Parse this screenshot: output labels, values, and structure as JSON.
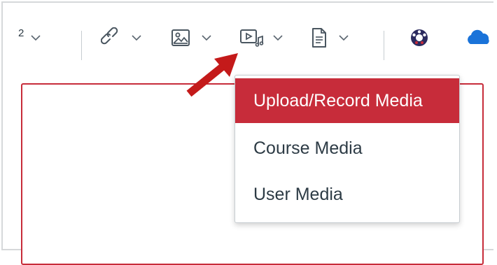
{
  "toolbar": {
    "heading_level": "2",
    "items": [
      {
        "icon": "heading-level"
      },
      {
        "icon": "link-icon"
      },
      {
        "icon": "image-icon"
      },
      {
        "icon": "media-icon"
      },
      {
        "icon": "document-icon"
      },
      {
        "icon": "apps-icon"
      },
      {
        "icon": "cloud-icon"
      }
    ]
  },
  "colors": {
    "accent": "#c72c3a",
    "text": "#2d3b45",
    "icon": "#4a5660",
    "divider": "#c7cdd1"
  },
  "media_menu": {
    "items": [
      {
        "label": "Upload/Record Media",
        "active": true
      },
      {
        "label": "Course Media",
        "active": false
      },
      {
        "label": "User Media",
        "active": false
      }
    ]
  }
}
